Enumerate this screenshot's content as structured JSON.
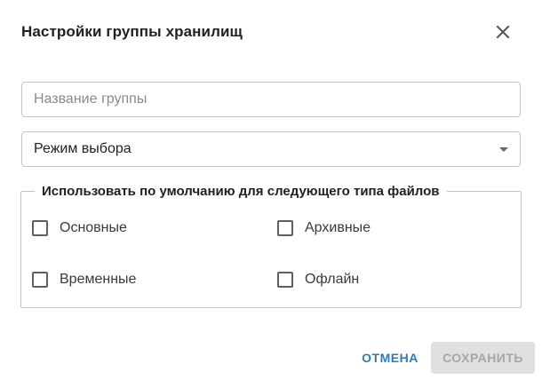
{
  "dialog": {
    "title": "Настройки группы хранилищ",
    "close_icon": "close-icon"
  },
  "form": {
    "group_name": {
      "value": "",
      "placeholder": "Название группы"
    },
    "selection_mode": {
      "selected": "Режим выбора",
      "icon": "chevron-down-icon"
    },
    "default_types": {
      "legend": "Использовать по умолчанию для следующего типа файлов",
      "options": [
        {
          "label": "Основные",
          "checked": false
        },
        {
          "label": "Архивные",
          "checked": false
        },
        {
          "label": "Временные",
          "checked": false
        },
        {
          "label": "Офлайн",
          "checked": false
        }
      ]
    }
  },
  "actions": {
    "cancel_label": "ОТМЕНА",
    "save_label": "СОХРАНИТЬ",
    "save_disabled": true
  },
  "colors": {
    "accent": "#2a7ac0",
    "border": "#c4c4c4",
    "disabled_bg": "#e0e0e0",
    "disabled_text": "#a6a6a6"
  }
}
